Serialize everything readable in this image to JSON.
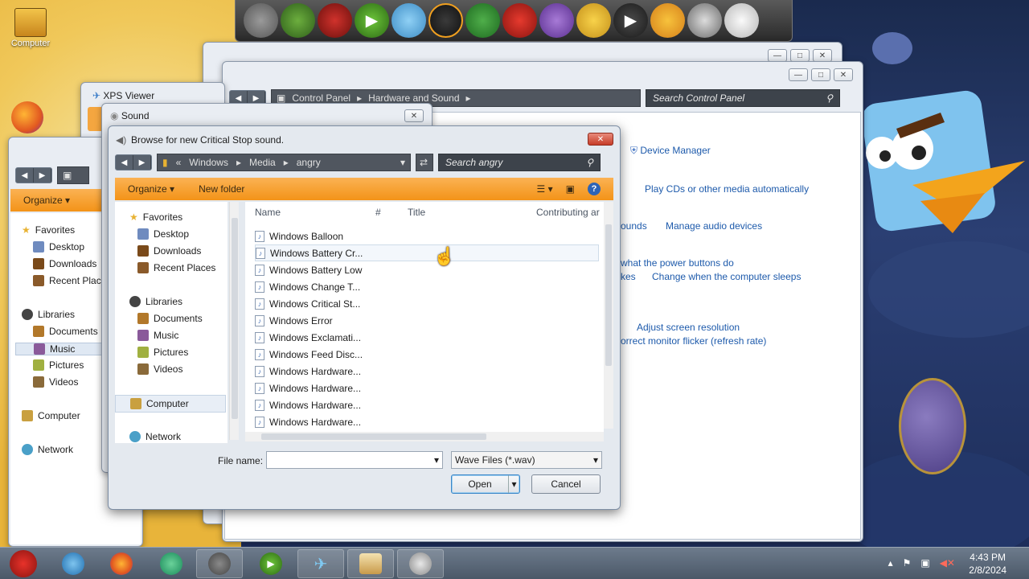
{
  "desktop": {
    "computer_label": "Computer"
  },
  "dock": {
    "icons": [
      "moon-icon",
      "green-pig-icon",
      "red-virus-icon",
      "play-icon",
      "blue-bird-icon",
      "black-bird-icon",
      "green-bird-icon",
      "red-bird-icon",
      "purple-bird-icon",
      "saturn-icon",
      "tv-icon",
      "golden-egg-icon",
      "astronaut-icon",
      "white-pig-icon"
    ]
  },
  "xps_viewer": {
    "title": "XPS Viewer"
  },
  "left_explorer": {
    "toolbar_organize": "Organize",
    "nav": [
      {
        "label": "Favorites",
        "indent": 0
      },
      {
        "label": "Desktop",
        "indent": 1
      },
      {
        "label": "Downloads",
        "indent": 1
      },
      {
        "label": "Recent Places",
        "indent": 1
      },
      {
        "label": "Libraries",
        "indent": 0
      },
      {
        "label": "Documents",
        "indent": 1
      },
      {
        "label": "Music",
        "indent": 1
      },
      {
        "label": "Pictures",
        "indent": 1
      },
      {
        "label": "Videos",
        "indent": 1
      },
      {
        "label": "Computer",
        "indent": 0
      },
      {
        "label": "Network",
        "indent": 0
      }
    ]
  },
  "control_panel": {
    "breadcrumb": [
      "Control Panel",
      "Hardware and Sound"
    ],
    "search_placeholder": "Search Control Panel",
    "links": {
      "device_manager": "Device Manager",
      "play_cds": "Play CDs or other media automatically",
      "sounds_partial": "ounds",
      "manage_audio": "Manage audio devices",
      "power_buttons": "what the power buttons do",
      "kes_partial": "kes",
      "computer_sleeps": "Change when the computer sleeps",
      "screen_resolution": "Adjust screen resolution",
      "monitor_flicker": "orrect monitor flicker (refresh rate)"
    }
  },
  "sound_window": {
    "title": "Sound"
  },
  "dialog": {
    "title": "Browse for new Critical Stop sound.",
    "path": [
      "Windows",
      "Media",
      "angry"
    ],
    "search_placeholder": "Search angry",
    "organize": "Organize",
    "new_folder": "New folder",
    "tree": [
      {
        "label": "Favorites",
        "type": "head"
      },
      {
        "label": "Desktop",
        "type": "item"
      },
      {
        "label": "Downloads",
        "type": "item"
      },
      {
        "label": "Recent Places",
        "type": "item"
      },
      {
        "label": "Libraries",
        "type": "head"
      },
      {
        "label": "Documents",
        "type": "item"
      },
      {
        "label": "Music",
        "type": "item"
      },
      {
        "label": "Pictures",
        "type": "item"
      },
      {
        "label": "Videos",
        "type": "item"
      },
      {
        "label": "Computer",
        "type": "head"
      },
      {
        "label": "Network",
        "type": "head"
      }
    ],
    "columns": [
      "Name",
      "#",
      "Title",
      "Contributing ar"
    ],
    "files": [
      "Windows Balloon",
      "Windows Battery Cr...",
      "Windows Battery Low",
      "Windows Change T...",
      "Windows Critical St...",
      "Windows Error",
      "Windows Exclamati...",
      "Windows Feed Disc...",
      "Windows Hardware...",
      "Windows Hardware...",
      "Windows Hardware...",
      "Windows Hardware..."
    ],
    "file_name_label": "File name:",
    "file_name_value": "",
    "file_type": "Wave Files (*.wav)",
    "open": "Open",
    "cancel": "Cancel"
  },
  "taskbar": {
    "time": "4:43 PM",
    "date": "2/8/2024"
  }
}
